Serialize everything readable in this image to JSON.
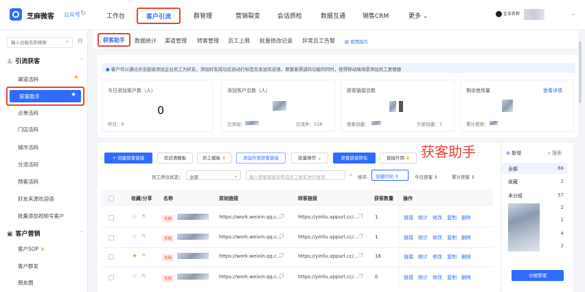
{
  "topbar": {
    "brand": "芝麻微客",
    "gzh": "公众号",
    "nav": [
      "工作台",
      "客户引流",
      "群管理",
      "营销裂变",
      "会话质检",
      "数据互通",
      "销售CRM",
      "更多"
    ],
    "user_label": "企业名称",
    "more_chevron": "⌄"
  },
  "sidebar": {
    "search_placeholder": "输入功能名称搜索",
    "section1_title": "引流获客",
    "section1_items": [
      "渠道活码",
      "获客助手",
      "点单活码",
      "门店活码",
      "城市活码",
      "分流活码",
      "预客活码",
      "好友来源欢迎语",
      "批量添加视频号客户"
    ],
    "section2_title": "客户营销",
    "section2_items": [
      "客户SOP",
      "客户群发",
      "朋友圈"
    ]
  },
  "tabs": {
    "items": [
      "获客助手",
      "数据统计",
      "渠道管理",
      "转客管理",
      "员工上限",
      "批量修改记录",
      "异常员工告警"
    ],
    "guide": "使用指引"
  },
  "notice": "客户可以通过点击链接添加企业员工为好友，添加好友成功后自动打标签及发送欢迎语，要客客渠道码功能的同时，使得移动端场景添加员工更便捷",
  "stats": {
    "today_title": "今日添加客户数（人）",
    "today_value": "0",
    "yesterday": "昨日：0",
    "total_title": "添加客户总数（人）",
    "added": "已添加：",
    "lost": "已流失：558",
    "links_title": "获客链接总数",
    "wk_created": "微客创建：",
    "ext_created": "外部创建：7",
    "remain_title": "剩余使用量",
    "view_detail": "查看详情",
    "total_used": "累计使用："
  },
  "toolbar": {
    "create": "+ 创建获客链接",
    "welcome_tpl": "欢迎语模板",
    "staff_tpl": "员工模板",
    "add_external": "添加外部获客链接",
    "batch": "批量操作",
    "convert": "获客链接转化",
    "ext_link": "链接外用",
    "big_title": "获客助手",
    "status_label": "员工席位状态：",
    "status_value": "全部",
    "search_placeholder": "输入获客链接名称或员工姓名进行查询",
    "sort_label": "排序:",
    "sort_created": "创建时间",
    "sort_today": "今日获客",
    "sort_total": "累计获客"
  },
  "table": {
    "headers": [
      "收藏/分享",
      "名称",
      "原始链接",
      "转客链接",
      "获客数量",
      "操作"
    ],
    "tag": "共用",
    "rows": [
      {
        "orig": "https://work.weixin.qq.c...",
        "conv": "https://yinliu.appurl.cc/...",
        "count": "1",
        "starred": false
      },
      {
        "orig": "https://work.weixin.qq.c...",
        "conv": "https://yinliu.appurl.cc/...",
        "count": "1",
        "starred": false
      },
      {
        "orig": "https://work.weixin.qq.c...",
        "conv": "https://yinliu.appurl.cc/...",
        "count": "16",
        "starred": true
      },
      {
        "orig": "https://work.weixin.qq.c...",
        "conv": "https://yinliu.appurl.cc/...",
        "count": "0",
        "starred": false
      }
    ],
    "ops": [
      "链接",
      "统计",
      "修改",
      "复制",
      "删除"
    ]
  },
  "right_panel": {
    "add": "新增",
    "search": "搜索",
    "groups": [
      {
        "name": "全部",
        "count": "66"
      },
      {
        "name": "收藏",
        "count": "2"
      },
      {
        "name": "未分组",
        "count": "57"
      }
    ],
    "extra_counts": [
      "2",
      "1",
      "4",
      "2"
    ],
    "manage": "分组管理"
  },
  "colors": {
    "accent": "#2f6bff",
    "highlight": "#e8412f",
    "star": "#f5a623"
  }
}
